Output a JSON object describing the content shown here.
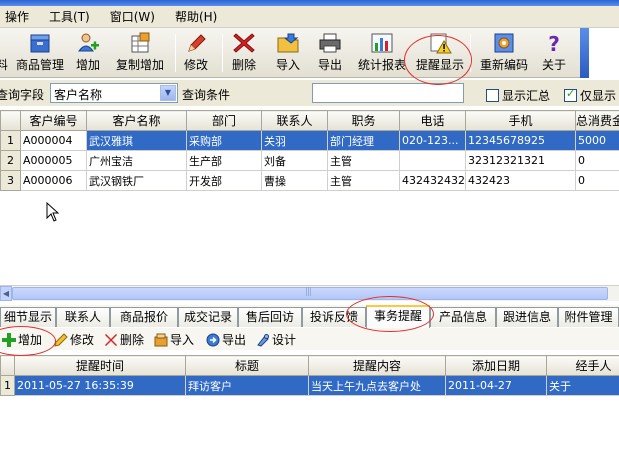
{
  "menu": [
    "操作",
    "工具(T)",
    "窗口(W)",
    "帮助(H)"
  ],
  "toolbar": [
    {
      "label": "料",
      "icon": "partial-icon"
    },
    {
      "label": "商品管理",
      "icon": "product-box-icon"
    },
    {
      "label": "增加",
      "icon": "add-user-icon"
    },
    {
      "label": "复制增加",
      "icon": "copy-add-icon"
    },
    {
      "label": "修改",
      "icon": "pencil-icon"
    },
    {
      "label": "删除",
      "icon": "delete-x-icon"
    },
    {
      "label": "导入",
      "icon": "import-folder-icon"
    },
    {
      "label": "导出",
      "icon": "export-printer-icon"
    },
    {
      "label": "统计报表",
      "icon": "bar-chart-icon"
    },
    {
      "label": "提醒显示",
      "icon": "reminder-warning-icon"
    },
    {
      "label": "重新编码",
      "icon": "recode-icon"
    },
    {
      "label": "关于",
      "icon": "help-question-icon"
    }
  ],
  "query": {
    "field_label": "查询字段",
    "field_value": "客户名称",
    "condition_label": "查询条件",
    "condition_value": "",
    "summary_label": "显示汇总",
    "summary_checked": false,
    "only_label": "仅显示",
    "only_checked": true
  },
  "customer_table": {
    "columns": [
      "",
      "客户编号",
      "客户名称",
      "部门",
      "联系人",
      "职务",
      "电话",
      "手机",
      "总消费金"
    ],
    "rows": [
      [
        "1",
        "A000004",
        "武汉雅琪",
        "采购部",
        "关羽",
        "部门经理",
        "020-123...",
        "12345678925",
        "5000"
      ],
      [
        "2",
        "A000005",
        "广州宝洁",
        "生产部",
        "刘备",
        "主管",
        "",
        "32312321321",
        "0"
      ],
      [
        "3",
        "A000006",
        "武汉钢铁厂",
        "开发部",
        "曹操",
        "主管",
        "432432432",
        "432423",
        "0"
      ]
    ]
  },
  "tabs": [
    "细节显示",
    "联系人",
    "商品报价",
    "成交记录",
    "售后回访",
    "投诉反馈",
    "事务提醒",
    "产品信息",
    "跟进信息",
    "附件管理"
  ],
  "active_tab": "事务提醒",
  "sub_toolbar": [
    {
      "label": "增加",
      "icon": "add-icon"
    },
    {
      "label": "修改",
      "icon": "edit-icon"
    },
    {
      "label": "删除",
      "icon": "delete-icon"
    },
    {
      "label": "导入",
      "icon": "import-icon"
    },
    {
      "label": "导出",
      "icon": "export-icon"
    },
    {
      "label": "设计",
      "icon": "design-icon"
    }
  ],
  "reminder_table": {
    "columns": [
      "",
      "提醒时间",
      "标题",
      "提醒内容",
      "添加日期",
      "经手人"
    ],
    "rows": [
      [
        "1",
        "2011-05-27 16:35:39",
        "拜访客户",
        "当天上午九点去客户处",
        "2011-04-27",
        "关于"
      ]
    ]
  },
  "colors": {
    "selection": "#316ac5",
    "annotation": "#e03030",
    "toolbar_accent": "#2a5bc0"
  }
}
